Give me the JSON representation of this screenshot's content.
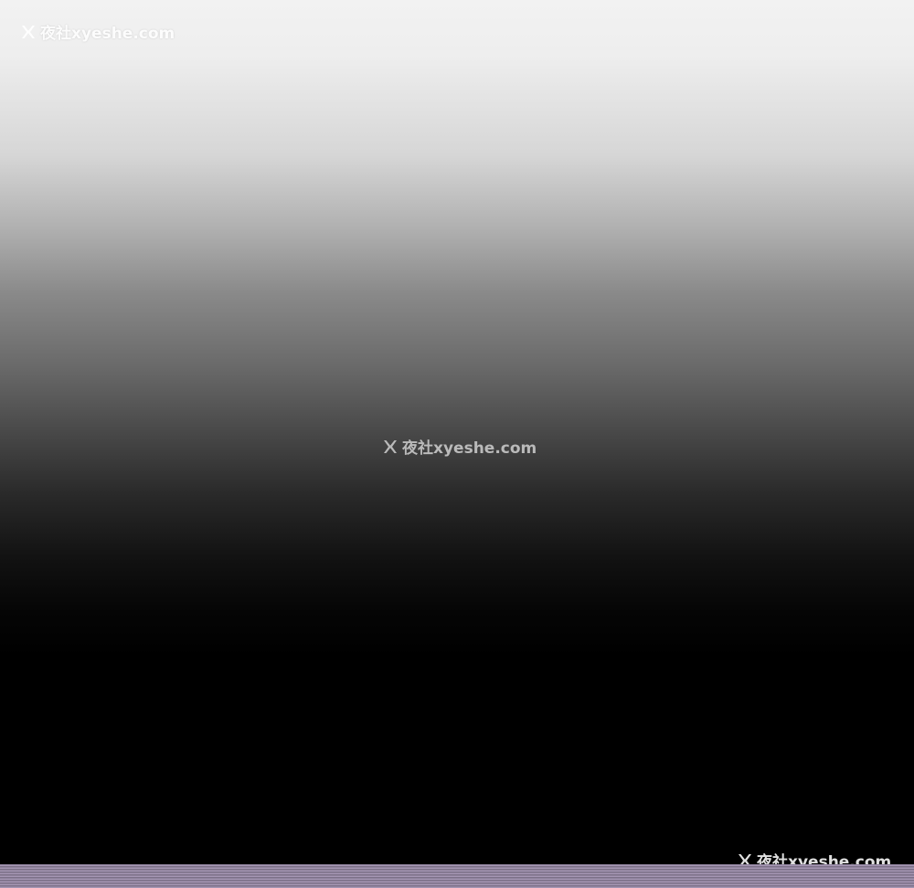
{
  "watermarks": {
    "top_left": {
      "text": "夜社xyeshe.com",
      "icon": "x-logo-icon"
    },
    "center": {
      "text": "夜社xyeshe.com",
      "icon": "x-logo-icon"
    },
    "bottom_right": {
      "text": "夜社xyeshe.com",
      "icon": "x-logo-icon"
    }
  },
  "colors": {
    "gradient_top": "#f2f2f2",
    "gradient_bottom": "#000000",
    "bottom_strip": "#8f829c"
  }
}
